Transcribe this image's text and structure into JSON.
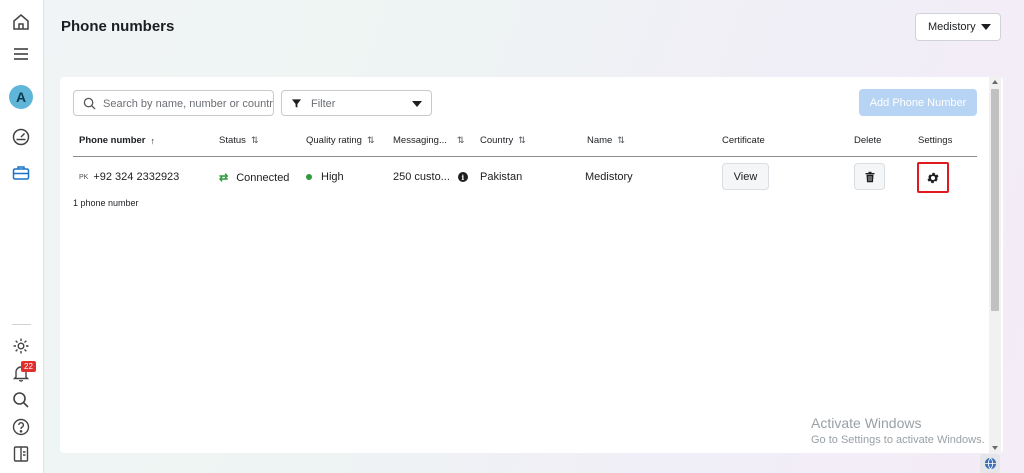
{
  "page": {
    "title": "Phone numbers"
  },
  "account_selector": {
    "value": "Medistory"
  },
  "rail": {
    "avatar_letter": "A",
    "notification_count": "22",
    "icons": [
      "home-icon",
      "menu-icon",
      "dashboard-gauge-icon",
      "briefcase-icon",
      "gear-icon",
      "bell-icon",
      "search-icon",
      "help-icon",
      "panel-icon"
    ]
  },
  "toolbar": {
    "search_placeholder": "Search by name, number or country",
    "filter_label": "Filter",
    "add_button": "Add Phone Number"
  },
  "table": {
    "columns": {
      "phone": "Phone number",
      "status": "Status",
      "quality": "Quality rating",
      "messaging": "Messaging...",
      "country": "Country",
      "name": "Name",
      "certificate": "Certificate",
      "delete": "Delete",
      "settings": "Settings"
    },
    "rows": [
      {
        "country_code": "PK",
        "phone": "+92 324 2332923",
        "status": "Connected",
        "quality": "High",
        "messaging": "250 custo...",
        "country": "Pakistan",
        "name": "Medistory",
        "certificate_button": "View"
      }
    ],
    "count_text": "1 phone number"
  },
  "watermark": {
    "line1": "Activate Windows",
    "line2": "Go to Settings to activate Windows."
  },
  "colors": {
    "primary_disabled": "#b7d4f4",
    "status_green": "#2e9b3b",
    "highlight_red": "#e0191f",
    "avatar": "#5fb6d8",
    "badge": "#e02f2f"
  }
}
